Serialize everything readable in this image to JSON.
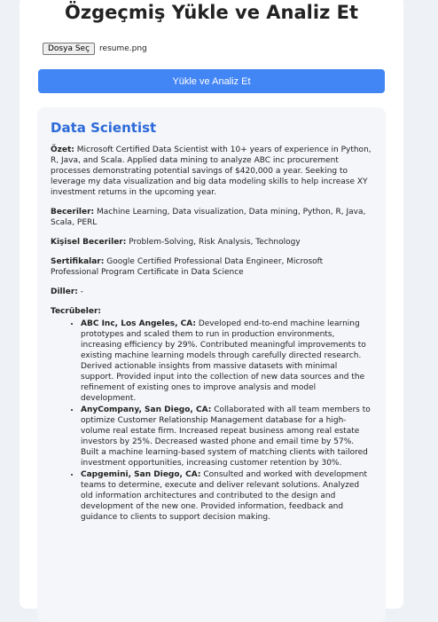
{
  "title": "Özgeçmiş Yükle ve Analiz Et",
  "file_button_label": "Dosya Seç",
  "file_name": "resume.png",
  "submit_label": "Yükle ve Analiz Et",
  "result": {
    "job_title": "Data Scientist",
    "summary_label": "Özet:",
    "summary": "Microsoft Certified Data Scientist with 10+ years of experience in Python, R, Java, and Scala. Applied data mining to analyze ABC inc procurement processes demonstrating potential savings of $420,000 a year. Seeking to leverage my data visualization and big data modeling skills to help increase XY investment returns in the upcoming year.",
    "skills_label": "Beceriler:",
    "skills": "Machine Learning, Data visualization, Data mining, Python, R, Java, Scala, PERL",
    "soft_skills_label": "Kişisel Beceriler:",
    "soft_skills": "Problem-Solving, Risk Analysis, Technology",
    "certs_label": "Sertifikalar:",
    "certs": "Google Certified Professional Data Engineer, Microsoft Professional Program Certificate in Data Science",
    "languages_label": "Diller:",
    "languages": "-",
    "experience_label": "Tecrübeler:",
    "experiences": [
      {
        "company": "ABC Inc, Los Angeles, CA:",
        "description": "Developed end-to-end machine learning prototypes and scaled them to run in production environments, increasing efficiency by 29%. Contributed meaningful improvements to existing machine learning models through carefully directed research. Derived actionable insights from massive datasets with minimal support. Provided input into the collection of new data sources and the refinement of existing ones to improve analysis and model development."
      },
      {
        "company": "AnyCompany, San Diego, CA:",
        "description": "Collaborated with all team members to optimize Customer Relationship Management database for a high-volume real estate firm. Increased repeat business among real estate investors by 25%. Decreased wasted phone and email time by 57%. Built a machine learning-based system of matching clients with tailored investment opportunities, increasing customer retention by 30%."
      },
      {
        "company": "Capgemini, San Diego, CA:",
        "description": "Consulted and worked with development teams to determine, execute and deliver relevant solutions. Analyzed old information architectures and contributed to the design and development of the new one. Provided information, feedback and guidance to clients to support decision making."
      }
    ]
  }
}
